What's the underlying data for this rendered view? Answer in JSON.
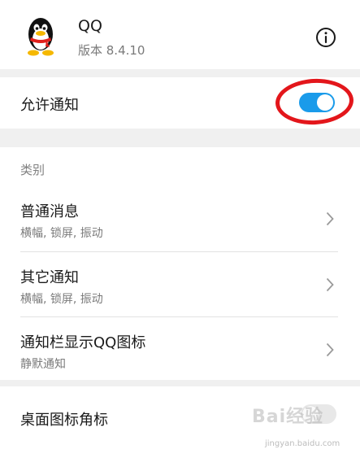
{
  "app": {
    "name": "QQ",
    "version": "版本 8.4.10"
  },
  "allow_notifications": {
    "label": "允许通知",
    "enabled": true,
    "toggle_color": "#1a9bea",
    "annotation_color": "#e3161b"
  },
  "categories": {
    "title": "类别",
    "items": [
      {
        "title": "普通消息",
        "subtitle": "横幅, 锁屏, 振动"
      },
      {
        "title": "其它通知",
        "subtitle": "横幅, 锁屏, 振动"
      },
      {
        "title": "通知栏显示QQ图标",
        "subtitle": "静默通知"
      }
    ]
  },
  "desktop_badge": {
    "label": "桌面图标角标",
    "enabled": false
  },
  "watermark": {
    "text": "Bai经验",
    "url": "jingyan.baidu.com"
  }
}
